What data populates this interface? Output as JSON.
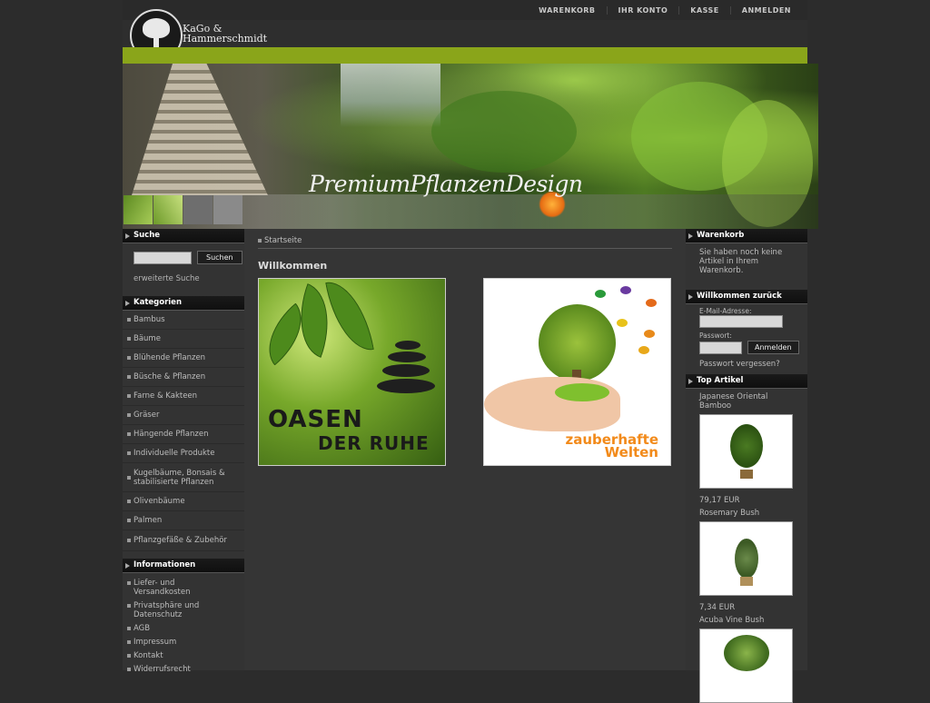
{
  "brand": {
    "line1": "KaGo &",
    "line2": "Hammerschmidt"
  },
  "topnav": [
    "WARENKORB",
    "IHR KONTO",
    "KASSE",
    "ANMELDEN"
  ],
  "banner": {
    "title": "PremiumPflanzenDesign"
  },
  "search": {
    "heading": "Suche",
    "button": "Suchen",
    "advanced": "erweiterte Suche",
    "value": ""
  },
  "categories": {
    "heading": "Kategorien",
    "items": [
      "Bambus",
      "Bäume",
      "Blühende Pflanzen",
      "Büsche & Pflanzen",
      "Farne & Kakteen",
      "Gräser",
      "Hängende Pflanzen",
      "Individuelle Produkte",
      "Kugelbäume, Bonsais & stabilisierte Pflanzen",
      "Olivenbäume",
      "Palmen",
      "Pflanzgefäße & Zubehör"
    ]
  },
  "info": {
    "heading": "Informationen",
    "items": [
      "Liefer- und Versandkosten",
      "Privatsphäre und Datenschutz",
      "AGB",
      "Impressum",
      "Kontakt",
      "Widerrufsrecht"
    ]
  },
  "main": {
    "breadcrumb": "Startseite",
    "heading": "Willkommen",
    "promo1": {
      "line1": "OASEN",
      "line2": "DER RUHE"
    },
    "promo2": {
      "line1": "zauberhafte",
      "line2": "Welten"
    }
  },
  "cart": {
    "heading": "Warenkorb",
    "text": "Sie haben noch keine Artikel in Ihrem Warenkorb."
  },
  "login": {
    "heading": "Willkommen zurück",
    "email_label": "E-Mail-Adresse:",
    "password_label": "Passwort:",
    "button": "Anmelden",
    "forgot": "Passwort vergessen?"
  },
  "top": {
    "heading": "Top Artikel",
    "items": [
      {
        "name": "Japanese Oriental Bamboo",
        "price": "79,17 EUR"
      },
      {
        "name": "Rosemary Bush",
        "price": "7,34 EUR"
      },
      {
        "name": "Acuba Vine Bush",
        "price": ""
      }
    ]
  },
  "colors": {
    "accent_green": "#8aa51a",
    "background": "#2c2c2c",
    "panel": "#353535"
  }
}
